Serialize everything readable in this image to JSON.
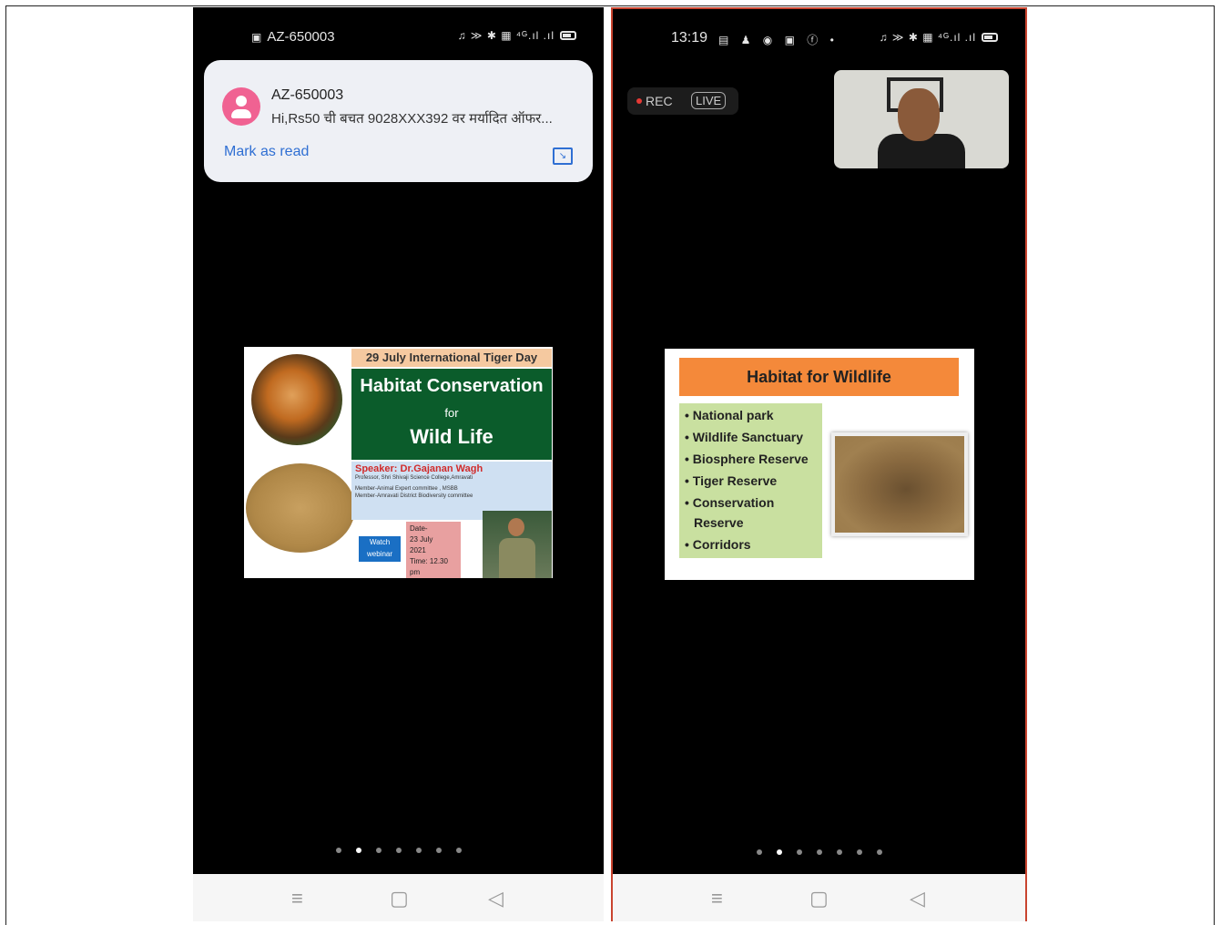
{
  "left_phone": {
    "status_bar": {
      "carrier": "AZ-650003",
      "right_icons": "♫ ≫ ✱ ▦ ⁴ᴳ.ıl .ıl"
    },
    "notification": {
      "sender": "AZ-650003",
      "message": "Hi,Rs50 ची बचत 9028XXX392 वर मर्यादित ऑफर...",
      "action": "Mark as read",
      "icon": "expand-icon"
    },
    "slide": {
      "banner": "29 July International Tiger Day",
      "title": "Habitat Conservation",
      "for": "for",
      "subtitle": "Wild Life",
      "speaker": "Speaker: Dr.Gajanan Wagh",
      "affiliation": "Professor, Shri Shivaji Science College,Amravati",
      "member1": "Member-Animal Expert committee , MSBB",
      "member2": "Member-Amravati District Biodiversity committee",
      "watch": "Watch webinar",
      "date_label": "Date-",
      "date_day": "23 July",
      "date_year": "2021",
      "time": "Time: 12.30",
      "pm": "pm"
    },
    "page_dots": {
      "count": 7,
      "active": 1
    }
  },
  "right_phone": {
    "status_bar": {
      "time": "13:19",
      "left_icons": "▤ ♟ ◉ ▣ ⓕ •",
      "right_icons": "♫ ≫ ✱ ▦ ⁴ᴳ.ıl .ıl"
    },
    "rec": {
      "label": "REC",
      "live": "LIVE"
    },
    "slide": {
      "title": "Habitat for Wildlife",
      "items": [
        "National park",
        "Wildlife Sanctuary",
        "Biosphere Reserve",
        "Tiger Reserve",
        "Conservation Reserve",
        "Corridors"
      ]
    },
    "page_dots": {
      "count": 7,
      "active": 1
    }
  },
  "nav": {
    "menu": "≡",
    "home": "▢",
    "back": "◁"
  },
  "colors": {
    "accent_red": "#c9442f",
    "notif_blue": "#2f6fd3",
    "avatar_pink": "#f06292",
    "slide_orange": "#f4893a",
    "slide_green": "#0b5c2b"
  }
}
